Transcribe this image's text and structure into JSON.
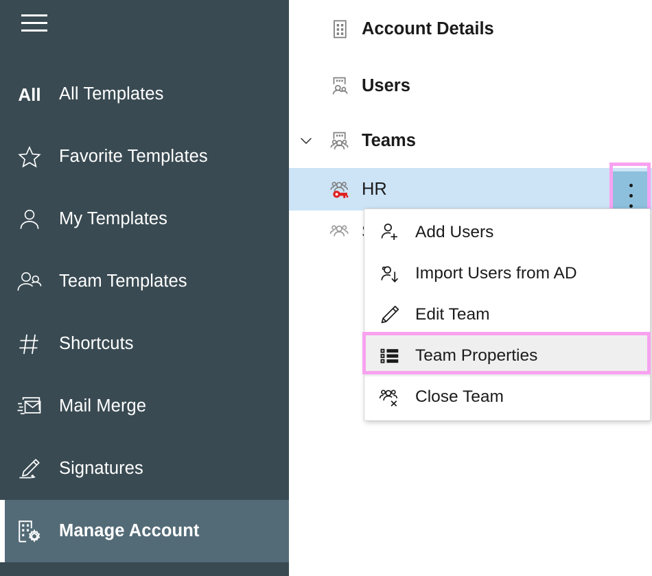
{
  "sidebar": {
    "menu_button": "hamburger-menu",
    "items": [
      {
        "label": "All Templates",
        "icon": "all-glyph",
        "active": false
      },
      {
        "label": "Favorite Templates",
        "icon": "star-icon",
        "active": false
      },
      {
        "label": "My Templates",
        "icon": "person-icon",
        "active": false
      },
      {
        "label": "Team Templates",
        "icon": "people-icon",
        "active": false
      },
      {
        "label": "Shortcuts",
        "icon": "hash-icon",
        "active": false
      },
      {
        "label": "Mail Merge",
        "icon": "mail-merge-icon",
        "active": false
      },
      {
        "label": "Signatures",
        "icon": "signature-pen-icon",
        "active": false
      },
      {
        "label": "Manage Account",
        "icon": "building-gear-icon",
        "active": true
      }
    ],
    "all_glyph_text": "All"
  },
  "tree": {
    "rows": [
      {
        "label": "Account Details",
        "icon": "building-icon",
        "indent": false,
        "chevron": "",
        "selected": false
      },
      {
        "label": "Users",
        "icon": "building-people-icon",
        "indent": false,
        "chevron": "",
        "selected": false
      },
      {
        "label": "Teams",
        "icon": "building-team-icon",
        "indent": false,
        "chevron": "v",
        "selected": false
      },
      {
        "label": "HR",
        "icon": "team-key-icon",
        "indent": true,
        "chevron": "",
        "selected": true
      },
      {
        "label": "S",
        "icon": "team-icon",
        "indent": true,
        "chevron": "",
        "selected": false
      }
    ],
    "row_actions_button": "more-options"
  },
  "context_menu": {
    "items": [
      {
        "label": "Add Users",
        "icon": "person-add-icon",
        "hovered": false
      },
      {
        "label": "Import Users from AD",
        "icon": "person-import-icon",
        "hovered": false
      },
      {
        "label": "Edit Team",
        "icon": "pencil-icon",
        "hovered": false
      },
      {
        "label": "Team Properties",
        "icon": "list-icon",
        "hovered": true
      },
      {
        "label": "Close Team",
        "icon": "people-remove-icon",
        "hovered": false
      }
    ]
  },
  "colors": {
    "sidebar_bg": "#394a52",
    "sidebar_active_bg": "#536b77",
    "selection_bg": "#cde4f7",
    "dots_button_bg": "#8dc0dd",
    "highlight_pink": "#f8a2f0",
    "menu_hover_bg": "#efefef",
    "key_red": "#e02020"
  }
}
